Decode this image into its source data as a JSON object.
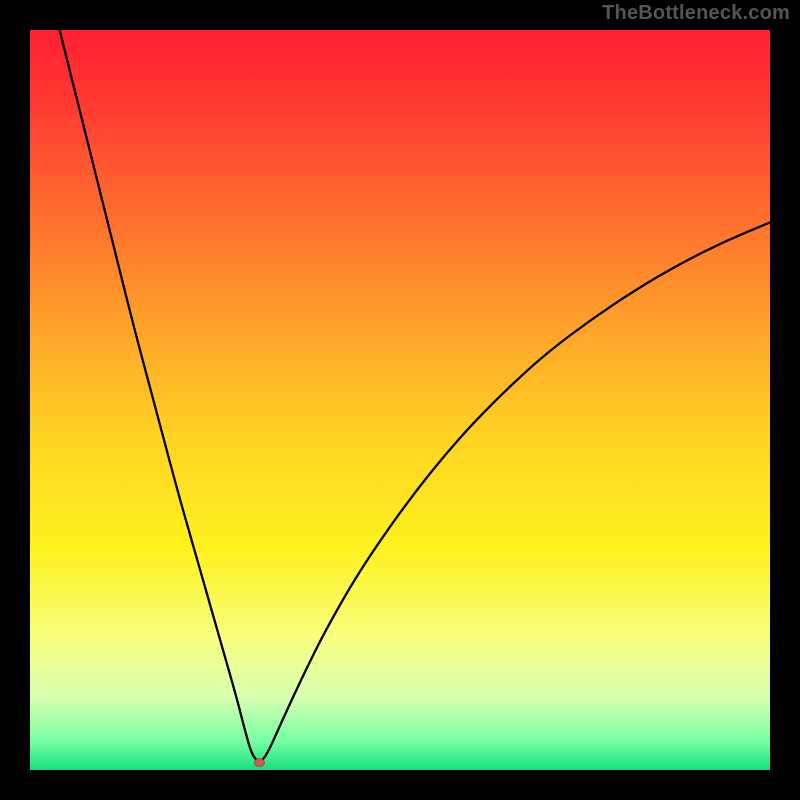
{
  "watermark": "TheBottleneck.com",
  "chart_data": {
    "type": "line",
    "title": "",
    "xlabel": "",
    "ylabel": "",
    "xlim": [
      0,
      100
    ],
    "ylim": [
      0,
      100
    ],
    "grid": false,
    "legend": false,
    "background_gradient_stops": [
      {
        "pos": 0.0,
        "color": "#ff2030"
      },
      {
        "pos": 0.1,
        "color": "#ff3a32"
      },
      {
        "pos": 0.24,
        "color": "#ff6a2e"
      },
      {
        "pos": 0.4,
        "color": "#ffa22a"
      },
      {
        "pos": 0.55,
        "color": "#ffd324"
      },
      {
        "pos": 0.7,
        "color": "#fef21e"
      },
      {
        "pos": 0.82,
        "color": "#f7ff7e"
      },
      {
        "pos": 0.9,
        "color": "#d8ffb0"
      },
      {
        "pos": 0.96,
        "color": "#7affa6"
      },
      {
        "pos": 1.0,
        "color": "#16e07d"
      }
    ],
    "series": [
      {
        "name": "bottleneck-curve",
        "x": [
          4,
          6,
          8,
          10,
          12,
          14,
          16,
          18,
          20,
          22,
          24,
          26,
          28,
          29,
          30,
          31,
          32,
          34,
          37,
          40,
          44,
          48,
          52,
          56,
          60,
          65,
          70,
          76,
          82,
          88,
          94,
          100
        ],
        "y": [
          100,
          92,
          84,
          76,
          68,
          60,
          52.5,
          45,
          37.5,
          30.5,
          23.5,
          16.5,
          9.5,
          5.5,
          2,
          1,
          2,
          6.5,
          13,
          19,
          26,
          32,
          37.5,
          42.5,
          47,
          52,
          56.5,
          61,
          65,
          68.5,
          71.5,
          74
        ]
      }
    ],
    "marker": {
      "name": "optimal-point",
      "x": 31,
      "y": 1,
      "rx": 5,
      "ry": 4
    }
  }
}
